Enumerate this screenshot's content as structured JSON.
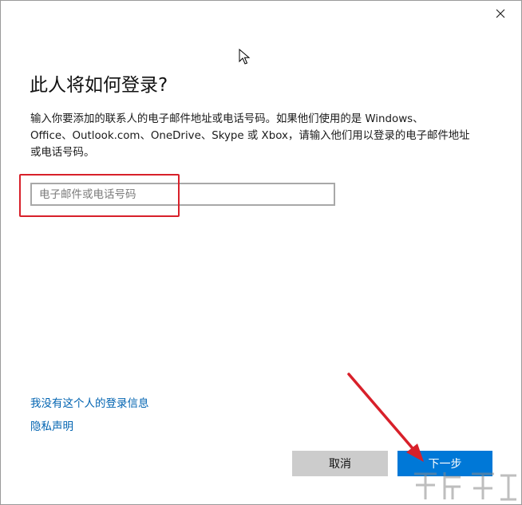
{
  "window": {
    "close_glyph": "✕"
  },
  "dialog": {
    "title": "此人将如何登录?",
    "description_lines": [
      "输入你要添加的联系人的电子邮件地址或电话号码。如果他们使用的是 Windows、",
      "Office、Outlook.com、OneDrive、Skype 或 Xbox，请输入他们用以登录的电子邮件地址",
      "或电话号码。"
    ],
    "input": {
      "placeholder": "电子邮件或电话号码",
      "value": ""
    },
    "links": {
      "no_info": "我没有这个人的登录信息",
      "privacy": "隐私声明"
    },
    "buttons": {
      "cancel": "取消",
      "next": "下一步"
    }
  },
  "colors": {
    "accent": "#0078d7",
    "link": "#0063b1",
    "highlight": "#d8202a",
    "cancel_bg": "#cccccc"
  },
  "icons": [
    "close-icon",
    "mouse-cursor-icon",
    "annotation-arrow-icon",
    "watermark-logo-icon"
  ]
}
